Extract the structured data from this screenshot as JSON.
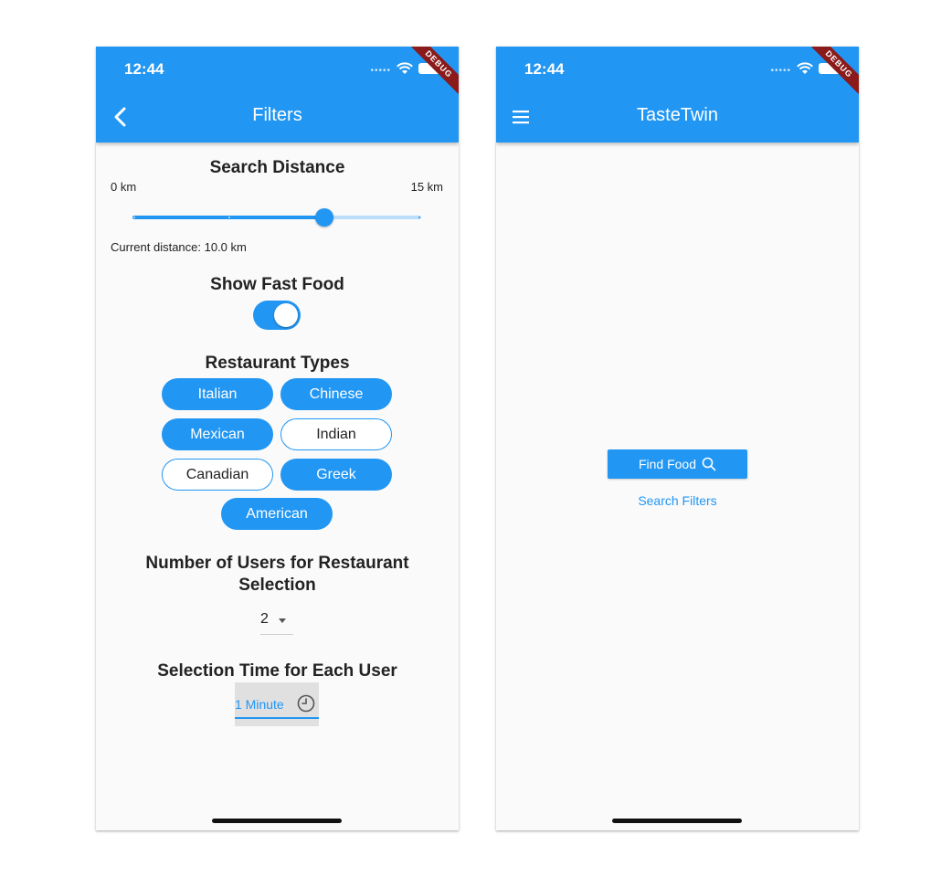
{
  "colors": {
    "primary": "#2196f3",
    "primary_light": "#bbdefb",
    "background": "#fafafa",
    "debug_ribbon": "#8b1a1a"
  },
  "status_bar": {
    "time": "12:44",
    "debug_label": "DEBUG"
  },
  "filters_screen": {
    "title": "Filters",
    "search_distance": {
      "heading": "Search Distance",
      "min_label": "0 km",
      "max_label": "15 km",
      "min": 0,
      "max": 15,
      "value": 10,
      "current_text": "Current distance: 10.0 km"
    },
    "fast_food": {
      "heading": "Show Fast Food",
      "enabled": true
    },
    "restaurant_types": {
      "heading": "Restaurant Types",
      "items": [
        {
          "label": "Italian",
          "selected": true
        },
        {
          "label": "Chinese",
          "selected": true
        },
        {
          "label": "Mexican",
          "selected": true
        },
        {
          "label": "Indian",
          "selected": false
        },
        {
          "label": "Canadian",
          "selected": false
        },
        {
          "label": "Greek",
          "selected": true
        },
        {
          "label": "American",
          "selected": true
        }
      ]
    },
    "users": {
      "heading_line1": "Number of Users for Restaurant",
      "heading_line2": "Selection",
      "value": "2"
    },
    "selection_time": {
      "heading": "Selection Time for Each User",
      "value": "1 Minute"
    }
  },
  "home_screen": {
    "title": "TasteTwin",
    "find_food_label": "Find Food",
    "search_filters_label": "Search Filters"
  },
  "icons": {
    "back": "chevron-left-icon",
    "menu": "menu-icon",
    "search": "search-icon",
    "clock": "clock-icon",
    "wifi": "wifi-icon",
    "battery": "battery-icon"
  }
}
